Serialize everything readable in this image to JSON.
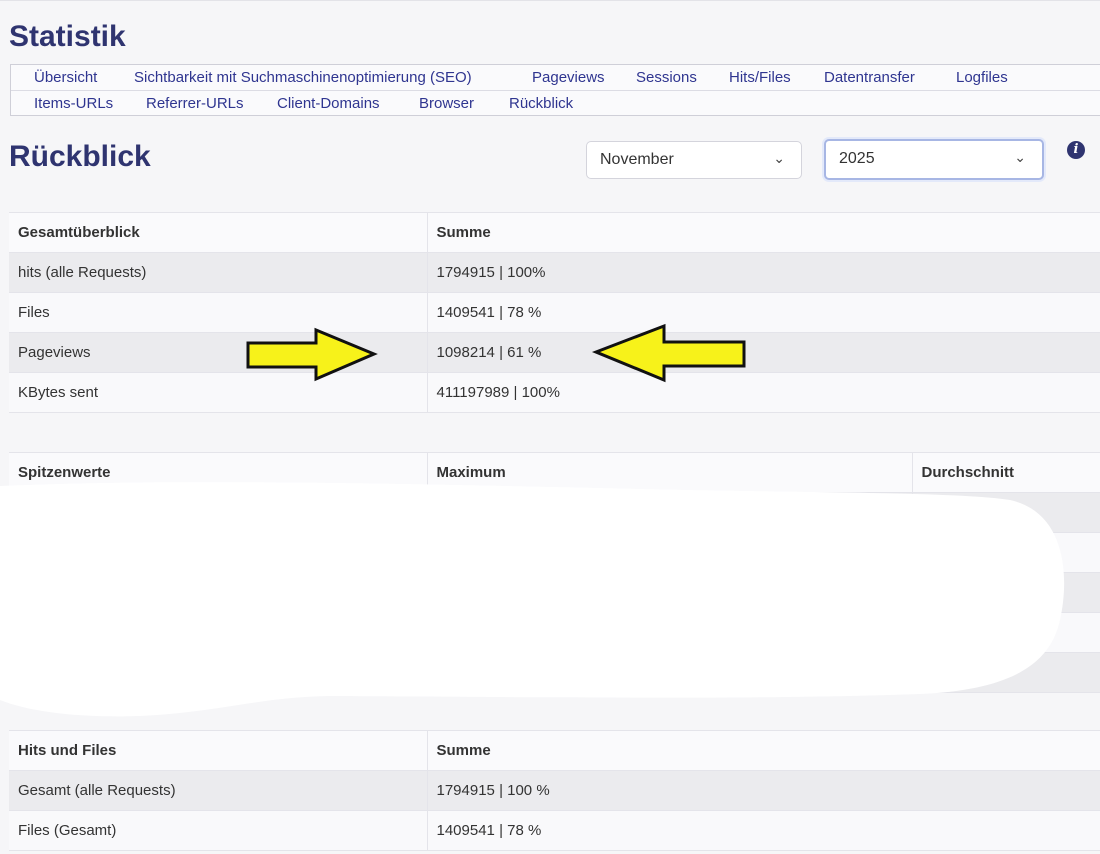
{
  "page_title": "Statistik",
  "nav": {
    "row1": [
      "Übersicht",
      "Sichtbarkeit mit Suchmaschinenoptimierung (SEO)",
      "Pageviews",
      "Sessions",
      "Hits/Files",
      "Datentransfer",
      "Logfiles"
    ],
    "row2": [
      "Items-URLs",
      "Referrer-URLs",
      "Client-Domains",
      "Browser",
      "Rückblick"
    ]
  },
  "section_title": "Rückblick",
  "filters": {
    "month": "November",
    "year": "2025",
    "chevron": "chevron-down-icon",
    "info_icon": "info-icon"
  },
  "overview_table": {
    "headers": [
      "Gesamtüberblick",
      "Summe"
    ],
    "rows": [
      [
        "hits (alle Requests)",
        "1794915 | 100%"
      ],
      [
        "Files",
        "1409541 | 78 %"
      ],
      [
        "Pageviews",
        "1098214 | 61 %"
      ],
      [
        "KBytes sent",
        "411197989 | 100%"
      ]
    ]
  },
  "peak_table": {
    "headers": [
      "Spitzenwerte",
      "Maximum",
      "Durchschnitt"
    ]
  },
  "hits_table": {
    "headers": [
      "Hits und Files",
      "Summe"
    ],
    "rows": [
      [
        "Gesamt (alle Requests)",
        "1794915 | 100 %"
      ],
      [
        "Files (Gesamt)",
        "1409541 | 78 %"
      ]
    ]
  },
  "colors": {
    "title": "#2f3470",
    "link": "#2f3590",
    "arrow_fill": "#f7f21a",
    "arrow_stroke": "#111111"
  }
}
